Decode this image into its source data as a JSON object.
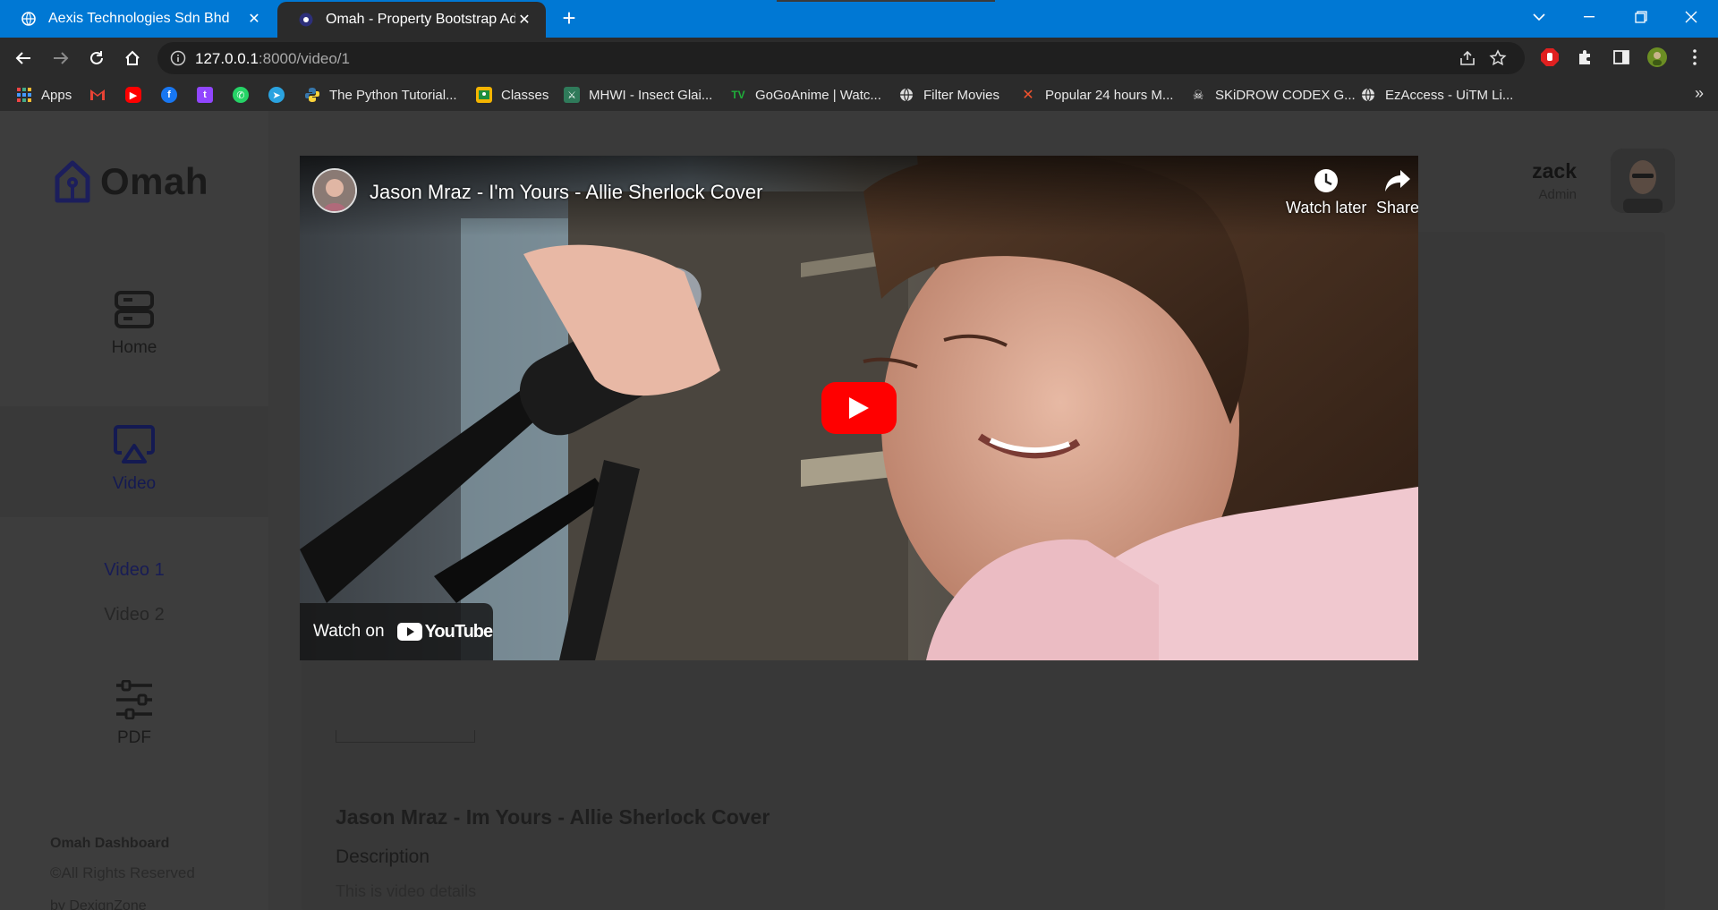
{
  "browser": {
    "tabs": [
      {
        "title": "Aexis Technologies Sdn Bhd",
        "icon": "globe-icon",
        "active": false
      },
      {
        "title": "Omah - Property Bootstrap Admi",
        "icon": "omah-favicon",
        "active": true
      }
    ],
    "url_host": "127.0.0.1",
    "url_rest": ":8000/video/1",
    "bookmarks": [
      {
        "label": "Apps",
        "icon": "apps-grid-icon"
      },
      {
        "label": "",
        "icon": "gmail-icon"
      },
      {
        "label": "",
        "icon": "youtube-icon"
      },
      {
        "label": "",
        "icon": "facebook-icon"
      },
      {
        "label": "",
        "icon": "twitch-icon"
      },
      {
        "label": "",
        "icon": "whatsapp-icon"
      },
      {
        "label": "",
        "icon": "telegram-icon"
      },
      {
        "label": "The Python Tutorial...",
        "icon": "python-icon"
      },
      {
        "label": "Classes",
        "icon": "classroom-icon"
      },
      {
        "label": "MHWI - Insect Glai...",
        "icon": "mhwi-icon"
      },
      {
        "label": "GoGoAnime | Watc...",
        "icon": "gogoanime-icon"
      },
      {
        "label": "Filter Movies",
        "icon": "globe-icon"
      },
      {
        "label": "Popular 24 hours M...",
        "icon": "x-icon"
      },
      {
        "label": "SKiDROW CODEX G...",
        "icon": "skull-icon"
      },
      {
        "label": "EzAccess - UiTM Li...",
        "icon": "globe-icon"
      }
    ],
    "bookmarks_more": "»"
  },
  "sidebar": {
    "logo": "Omah",
    "nav": [
      {
        "label": "Home",
        "icon": "home-dashboard-icon"
      },
      {
        "label": "Video",
        "icon": "airplay-icon",
        "active": true
      },
      {
        "label": "PDF",
        "icon": "sliders-icon"
      }
    ],
    "sub_items": [
      {
        "label": "Video 1",
        "active": true
      },
      {
        "label": "Video 2",
        "active": false
      }
    ],
    "footer_title": "Omah Dashboard",
    "footer_rights": "©All Rights Reserved",
    "footer_by": "by DexignZone"
  },
  "header": {
    "user_name": "zack",
    "user_role": "Admin"
  },
  "player": {
    "title": "Jason Mraz - I'm Yours - Allie Sherlock Cover",
    "watch_later": "Watch later",
    "share": "Share",
    "watch_on": "Watch on",
    "youtube": "YouTube"
  },
  "content": {
    "video_title": "Jason Mraz - Im Yours - Allie Sherlock Cover",
    "description_label": "Description",
    "description_text": "This is video details"
  },
  "colors": {
    "browser_accent": "#0078d4",
    "sidebar_active": "#1c1e5c",
    "play_button": "#ff0000"
  }
}
